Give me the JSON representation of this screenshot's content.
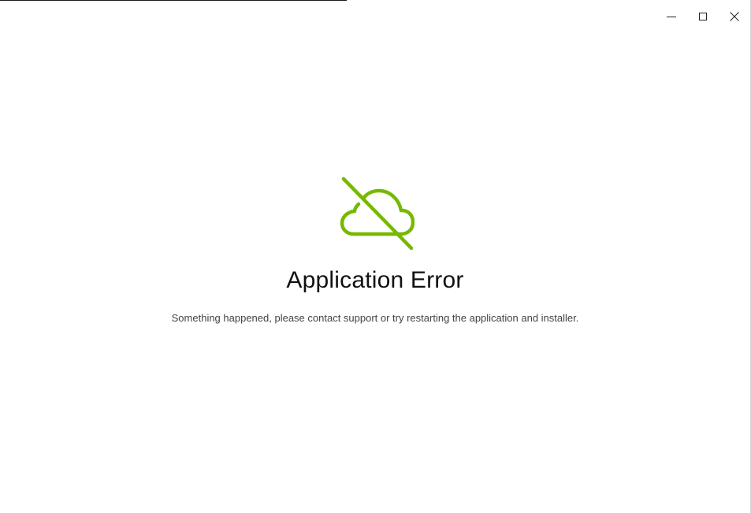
{
  "window": {
    "controls": {
      "minimize_icon": "minimize-icon",
      "maximize_icon": "maximize-icon",
      "close_icon": "close-icon"
    }
  },
  "error": {
    "icon": "cloud-off-icon",
    "icon_color": "#76b900",
    "title": "Application Error",
    "message": "Something happened, please contact support or try restarting the application and installer."
  }
}
